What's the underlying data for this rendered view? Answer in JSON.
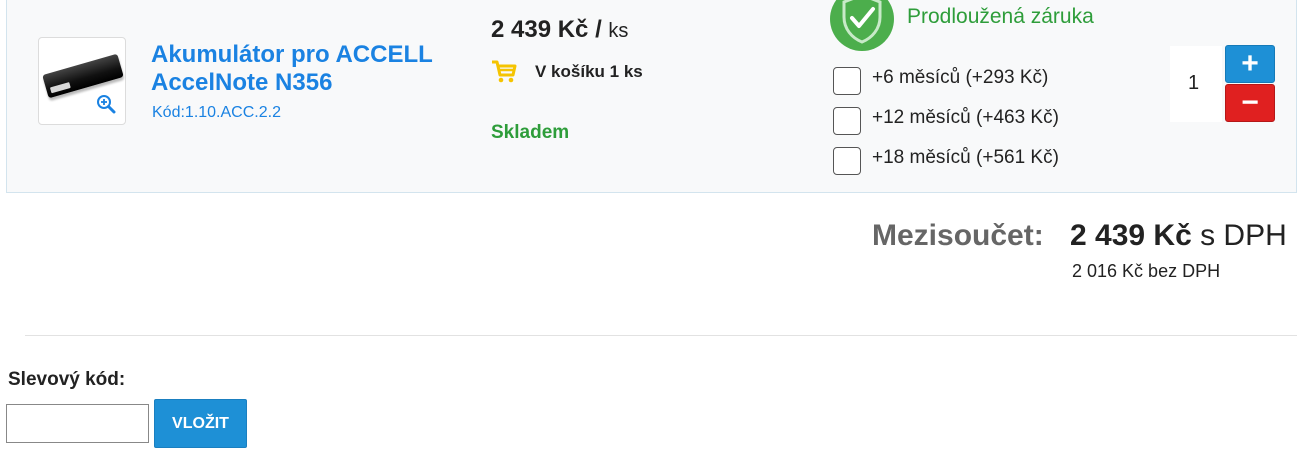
{
  "product": {
    "name": "Akumulátor pro ACCELL AccelNote N356",
    "code": "Kód:1.10.ACC.2.2",
    "price": "2 439 Kč",
    "price_sep": " / ",
    "price_unit": "ks",
    "in_cart": "V košíku 1 ks",
    "stock": "Skladem",
    "image_icon": "battery-product-image",
    "zoom_icon": "zoom-in-icon"
  },
  "warranty": {
    "title": "Prodloužená záruka",
    "icon": "shield-check-icon",
    "options": [
      {
        "label": "+6 měsíců (+293 Kč)",
        "checked": false
      },
      {
        "label": "+12 měsíců (+463 Kč)",
        "checked": false
      },
      {
        "label": "+18 měsíců (+561 Kč)",
        "checked": false
      }
    ]
  },
  "quantity": {
    "value": "1",
    "plus": "+",
    "minus": "−"
  },
  "subtotal": {
    "label": "Mezisoučet:",
    "value": "2 439 Kč",
    "suffix": " s DPH",
    "net": "2 016 Kč bez DPH"
  },
  "discount": {
    "label": "Slevový kód:",
    "value": "",
    "button": "VLOŽIT"
  },
  "colors": {
    "link": "#1a82e2",
    "success": "#2e9d3a",
    "primary_button": "#1e90d6",
    "danger_button": "#e02020"
  }
}
